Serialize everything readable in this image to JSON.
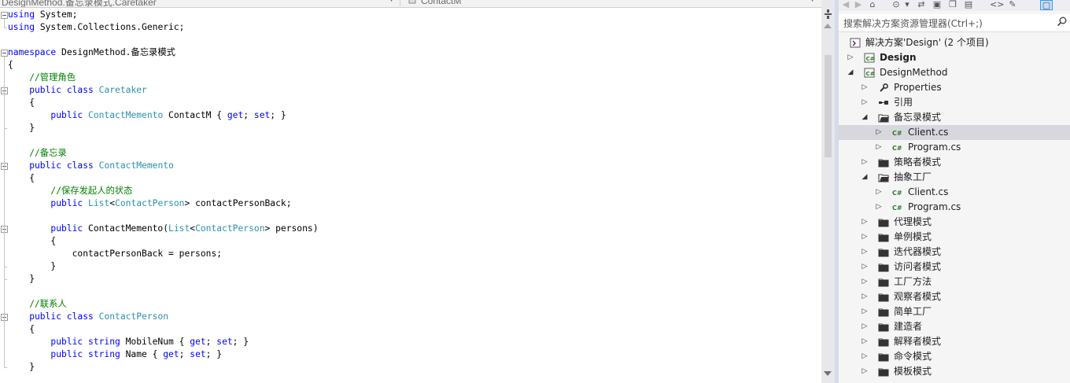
{
  "navbar": {
    "left_combo": "DesignMethod.备忘录模式.Caretaker",
    "right_combo": "ContactM"
  },
  "code": {
    "lines": [
      {
        "parts": [
          {
            "t": "kw",
            "s": "using"
          },
          {
            "t": "",
            "s": " System;"
          }
        ]
      },
      {
        "parts": [
          {
            "t": "kw",
            "s": "using"
          },
          {
            "t": "",
            "s": " System.Collections.Generic;"
          }
        ]
      },
      {
        "parts": []
      },
      {
        "parts": [
          {
            "t": "kw",
            "s": "namespace"
          },
          {
            "t": "",
            "s": " DesignMethod.备忘录模式"
          }
        ]
      },
      {
        "parts": [
          {
            "t": "",
            "s": "{"
          }
        ]
      },
      {
        "parts": [
          {
            "t": "cm",
            "s": "    //管理角色"
          }
        ]
      },
      {
        "parts": [
          {
            "t": "kw",
            "s": "    public class"
          },
          {
            "t": "",
            "s": " "
          },
          {
            "t": "ty",
            "s": "Caretaker"
          }
        ]
      },
      {
        "parts": [
          {
            "t": "",
            "s": "    {"
          }
        ]
      },
      {
        "parts": [
          {
            "t": "kw",
            "s": "        public"
          },
          {
            "t": "",
            "s": " "
          },
          {
            "t": "ty",
            "s": "ContactMemento"
          },
          {
            "t": "",
            "s": " ContactM { "
          },
          {
            "t": "kw",
            "s": "get"
          },
          {
            "t": "",
            "s": "; "
          },
          {
            "t": "kw",
            "s": "set"
          },
          {
            "t": "",
            "s": "; }"
          }
        ]
      },
      {
        "parts": [
          {
            "t": "",
            "s": "    }"
          }
        ]
      },
      {
        "parts": []
      },
      {
        "parts": [
          {
            "t": "cm",
            "s": "    //备忘录"
          }
        ]
      },
      {
        "parts": [
          {
            "t": "kw",
            "s": "    public class"
          },
          {
            "t": "",
            "s": " "
          },
          {
            "t": "ty",
            "s": "ContactMemento"
          }
        ]
      },
      {
        "parts": [
          {
            "t": "",
            "s": "    {"
          }
        ]
      },
      {
        "parts": [
          {
            "t": "cm",
            "s": "        //保存发起人的状态"
          }
        ]
      },
      {
        "parts": [
          {
            "t": "kw",
            "s": "        public"
          },
          {
            "t": "",
            "s": " "
          },
          {
            "t": "ty",
            "s": "List"
          },
          {
            "t": "",
            "s": "<"
          },
          {
            "t": "ty",
            "s": "ContactPerson"
          },
          {
            "t": "",
            "s": "> contactPersonBack;"
          }
        ]
      },
      {
        "parts": []
      },
      {
        "parts": [
          {
            "t": "kw",
            "s": "        public"
          },
          {
            "t": "",
            "s": " ContactMemento("
          },
          {
            "t": "ty",
            "s": "List"
          },
          {
            "t": "",
            "s": "<"
          },
          {
            "t": "ty",
            "s": "ContactPerson"
          },
          {
            "t": "",
            "s": "> persons)"
          }
        ]
      },
      {
        "parts": [
          {
            "t": "",
            "s": "        {"
          }
        ]
      },
      {
        "parts": [
          {
            "t": "",
            "s": "            contactPersonBack = persons;"
          }
        ]
      },
      {
        "parts": [
          {
            "t": "",
            "s": "        }"
          }
        ]
      },
      {
        "parts": [
          {
            "t": "",
            "s": "    }"
          }
        ]
      },
      {
        "parts": []
      },
      {
        "parts": [
          {
            "t": "cm",
            "s": "    //联系人"
          }
        ]
      },
      {
        "parts": [
          {
            "t": "kw",
            "s": "    public class"
          },
          {
            "t": "",
            "s": " "
          },
          {
            "t": "ty",
            "s": "ContactPerson"
          }
        ]
      },
      {
        "parts": [
          {
            "t": "",
            "s": "    {"
          }
        ]
      },
      {
        "parts": [
          {
            "t": "kw",
            "s": "        public string"
          },
          {
            "t": "",
            "s": " MobileNum { "
          },
          {
            "t": "kw",
            "s": "get"
          },
          {
            "t": "",
            "s": "; "
          },
          {
            "t": "kw",
            "s": "set"
          },
          {
            "t": "",
            "s": "; }"
          }
        ]
      },
      {
        "parts": [
          {
            "t": "kw",
            "s": "        public string"
          },
          {
            "t": "",
            "s": " Name { "
          },
          {
            "t": "kw",
            "s": "get"
          },
          {
            "t": "",
            "s": "; "
          },
          {
            "t": "kw",
            "s": "set"
          },
          {
            "t": "",
            "s": "; }"
          }
        ]
      },
      {
        "parts": [
          {
            "t": "",
            "s": "    }"
          }
        ]
      }
    ]
  },
  "solution_explorer": {
    "toolbar_icons": [
      "back-icon",
      "forward-icon",
      "home-icon",
      "history-icon",
      "sync-icon",
      "collapse-icon",
      "copy-icon",
      "code-icon",
      "wrench-icon",
      "preview-icon"
    ],
    "search_placeholder": "搜索解决方案资源管理器(Ctrl+;)",
    "items": [
      {
        "label": "解决方案'Design' (2 个项目)",
        "level": 0,
        "icon": "solution",
        "expander": "none",
        "bold": false,
        "selected": false
      },
      {
        "label": "Design",
        "level": 1,
        "icon": "csproj",
        "expander": "collapsed",
        "bold": true,
        "selected": false
      },
      {
        "label": "DesignMethod",
        "level": 1,
        "icon": "csproj",
        "expander": "expanded",
        "bold": false,
        "selected": false
      },
      {
        "label": "Properties",
        "level": 2,
        "icon": "wrench",
        "expander": "collapsed",
        "bold": false,
        "selected": false
      },
      {
        "label": "引用",
        "level": 2,
        "icon": "references",
        "expander": "collapsed",
        "bold": false,
        "selected": false
      },
      {
        "label": "备忘录模式",
        "level": 2,
        "icon": "folder-open",
        "expander": "expanded",
        "bold": false,
        "selected": false
      },
      {
        "label": "Client.cs",
        "level": 3,
        "icon": "csfile",
        "expander": "collapsed",
        "bold": false,
        "selected": true
      },
      {
        "label": "Program.cs",
        "level": 3,
        "icon": "csfile",
        "expander": "collapsed",
        "bold": false,
        "selected": false
      },
      {
        "label": "策略者模式",
        "level": 2,
        "icon": "folder",
        "expander": "collapsed",
        "bold": false,
        "selected": false
      },
      {
        "label": "抽象工厂",
        "level": 2,
        "icon": "folder-open",
        "expander": "expanded",
        "bold": false,
        "selected": false
      },
      {
        "label": "Client.cs",
        "level": 3,
        "icon": "csfile",
        "expander": "collapsed",
        "bold": false,
        "selected": false
      },
      {
        "label": "Program.cs",
        "level": 3,
        "icon": "csfile",
        "expander": "collapsed",
        "bold": false,
        "selected": false
      },
      {
        "label": "代理模式",
        "level": 2,
        "icon": "folder",
        "expander": "collapsed",
        "bold": false,
        "selected": false
      },
      {
        "label": "单例模式",
        "level": 2,
        "icon": "folder",
        "expander": "collapsed",
        "bold": false,
        "selected": false
      },
      {
        "label": "迭代器模式",
        "level": 2,
        "icon": "folder",
        "expander": "collapsed",
        "bold": false,
        "selected": false
      },
      {
        "label": "访问者模式",
        "level": 2,
        "icon": "folder",
        "expander": "collapsed",
        "bold": false,
        "selected": false
      },
      {
        "label": "工厂方法",
        "level": 2,
        "icon": "folder",
        "expander": "collapsed",
        "bold": false,
        "selected": false
      },
      {
        "label": "观察者模式",
        "level": 2,
        "icon": "folder",
        "expander": "collapsed",
        "bold": false,
        "selected": false
      },
      {
        "label": "简单工厂",
        "level": 2,
        "icon": "folder",
        "expander": "collapsed",
        "bold": false,
        "selected": false
      },
      {
        "label": "建造者",
        "level": 2,
        "icon": "folder",
        "expander": "collapsed",
        "bold": false,
        "selected": false
      },
      {
        "label": "解释者模式",
        "level": 2,
        "icon": "folder",
        "expander": "collapsed",
        "bold": false,
        "selected": false
      },
      {
        "label": "命令模式",
        "level": 2,
        "icon": "folder",
        "expander": "collapsed",
        "bold": false,
        "selected": false
      },
      {
        "label": "模板模式",
        "level": 2,
        "icon": "folder",
        "expander": "collapsed",
        "bold": false,
        "selected": false
      }
    ]
  },
  "colors": {
    "keyword": "#0000ff",
    "type": "#2b91af",
    "comment": "#008000",
    "selection": "#d7d7dd"
  }
}
